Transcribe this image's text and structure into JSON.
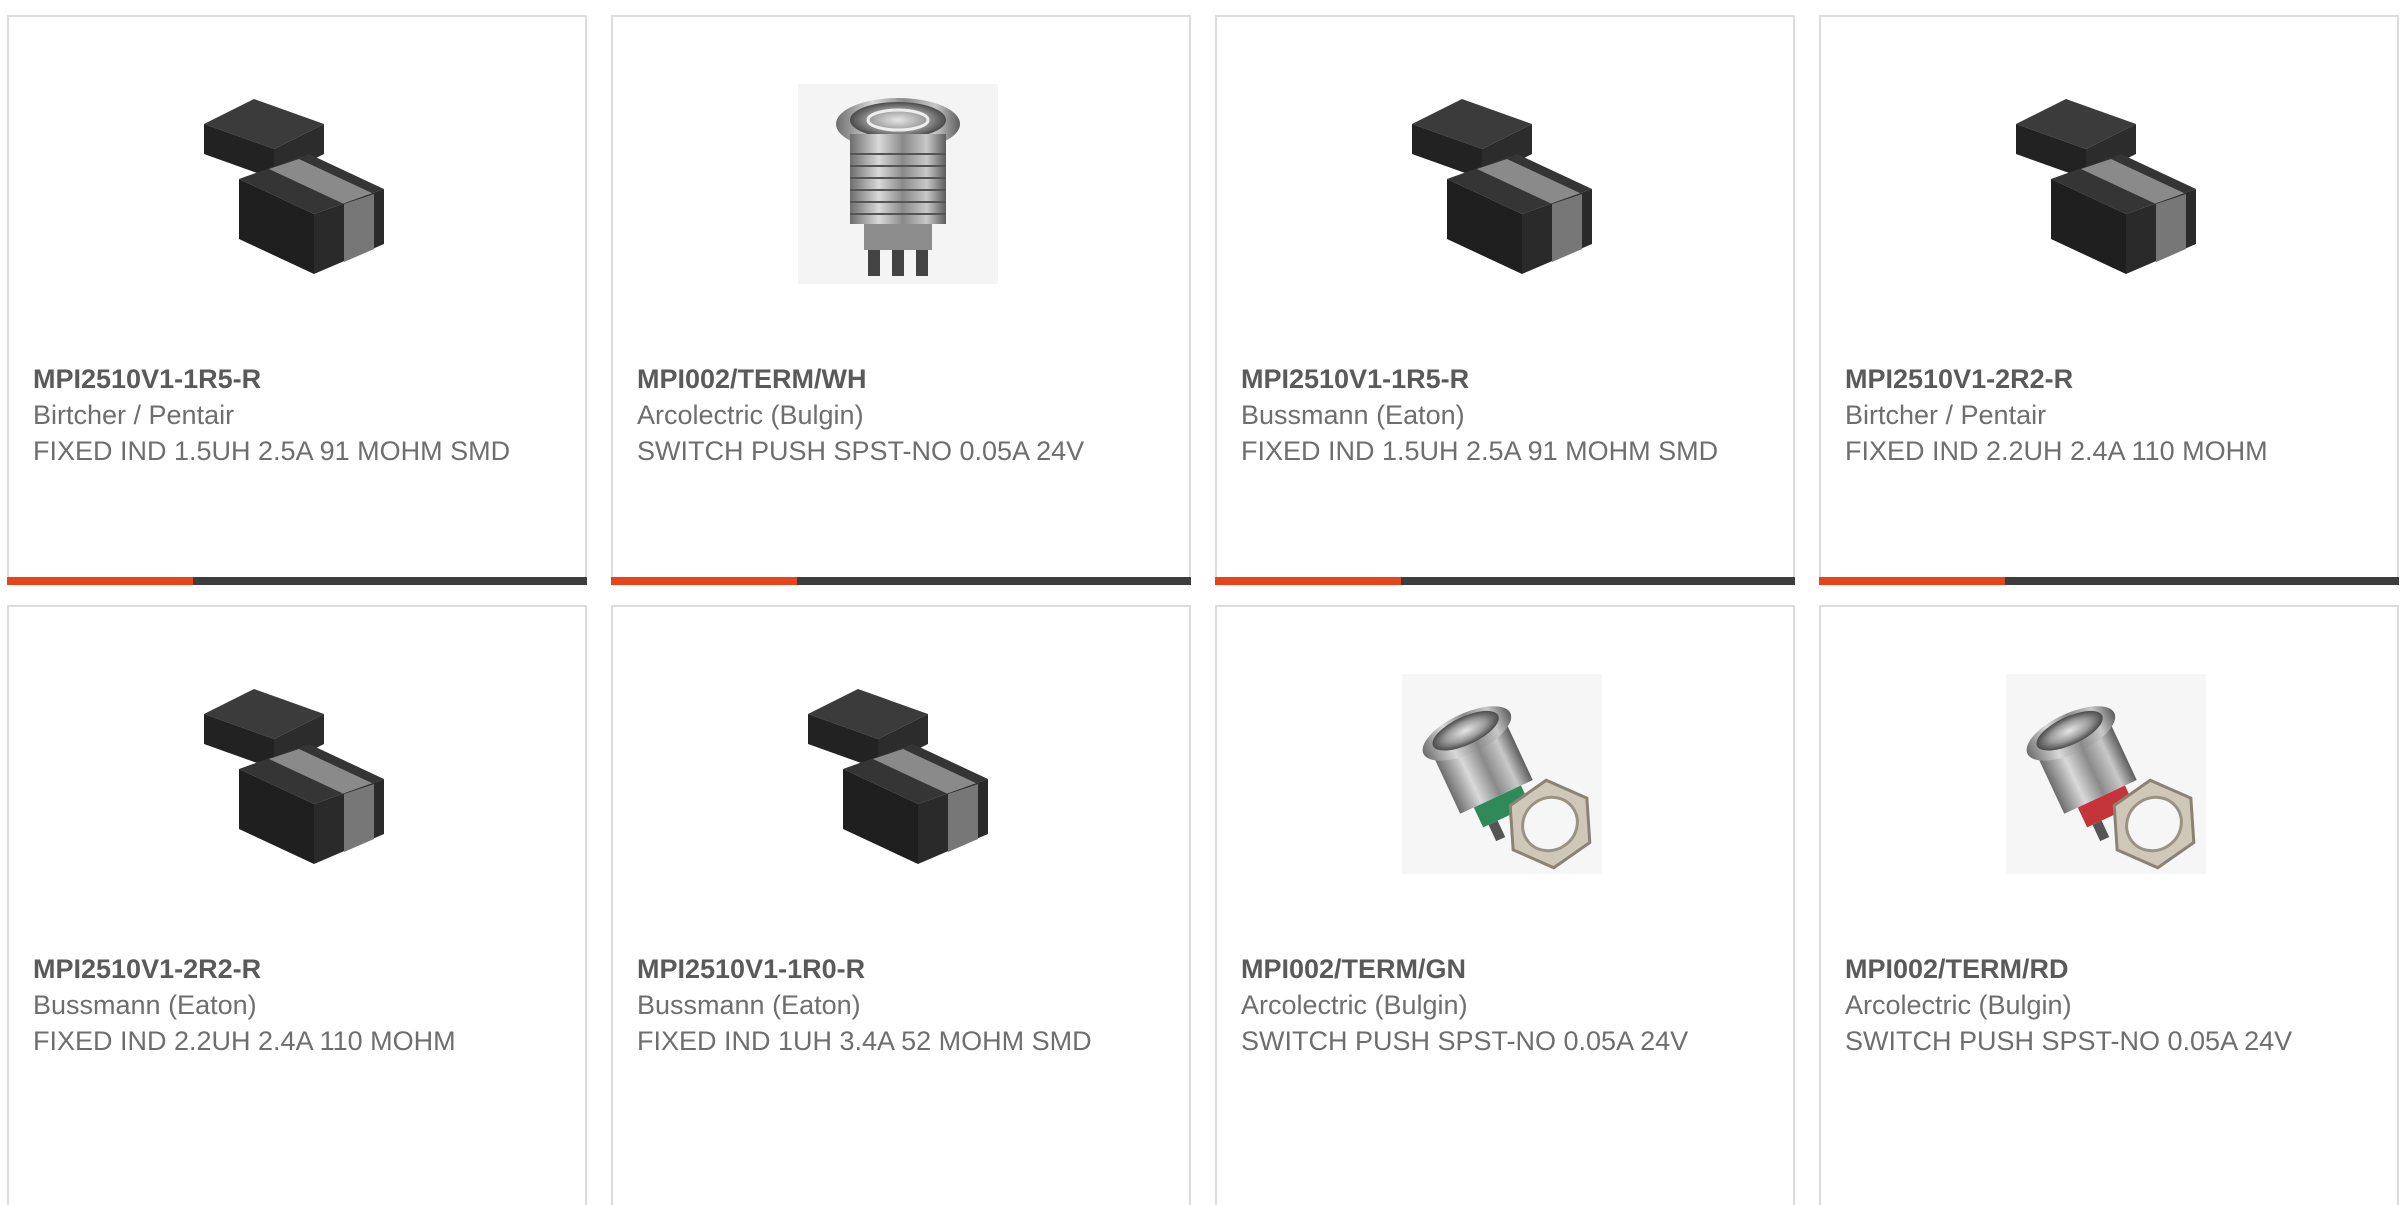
{
  "colors": {
    "accent": "#e8441c",
    "bar_track": "#3d3d3d",
    "border": "#dcdcdc",
    "text": "#6e6e6e"
  },
  "products": [
    {
      "part_number": "MPI2510V1-1R5-R",
      "manufacturer": "Birtcher / Pentair",
      "description": "FIXED IND 1.5UH 2.5A 91 MOHM SMD",
      "image_icon": "inductor-image",
      "progress": 0.32
    },
    {
      "part_number": "MPI002/TERM/WH",
      "manufacturer": "Arcolectric (Bulgin)",
      "description": "SWITCH PUSH SPST-NO 0.05A 24V",
      "image_icon": "push-switch-image",
      "progress": 0.32
    },
    {
      "part_number": "MPI2510V1-1R5-R",
      "manufacturer": "Bussmann (Eaton)",
      "description": "FIXED IND 1.5UH 2.5A 91 MOHM SMD",
      "image_icon": "inductor-image",
      "progress": 0.32
    },
    {
      "part_number": "MPI2510V1-2R2-R",
      "manufacturer": "Birtcher / Pentair",
      "description": "FIXED IND 2.2UH 2.4A 110 MOHM",
      "image_icon": "inductor-image",
      "progress": 0.32
    },
    {
      "part_number": "MPI2510V1-2R2-R",
      "manufacturer": "Bussmann (Eaton)",
      "description": "FIXED IND 2.2UH 2.4A 110 MOHM",
      "image_icon": "inductor-image"
    },
    {
      "part_number": "MPI2510V1-1R0-R",
      "manufacturer": "Bussmann (Eaton)",
      "description": "FIXED IND 1UH 3.4A 52 MOHM SMD",
      "image_icon": "inductor-image"
    },
    {
      "part_number": "MPI002/TERM/GN",
      "manufacturer": "Arcolectric (Bulgin)",
      "description": "SWITCH PUSH SPST-NO 0.05A 24V",
      "image_icon": "switch-with-nut-image",
      "switch_color": "#2f8a5a"
    },
    {
      "part_number": "MPI002/TERM/RD",
      "manufacturer": "Arcolectric (Bulgin)",
      "description": "SWITCH PUSH SPST-NO 0.05A 24V",
      "image_icon": "switch-with-nut-image",
      "switch_color": "#c4343a"
    }
  ]
}
